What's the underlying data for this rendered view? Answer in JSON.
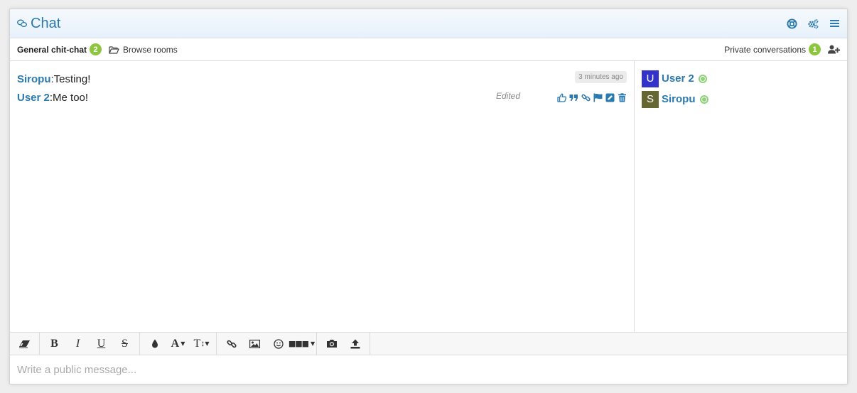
{
  "header": {
    "title": "Chat",
    "icons": [
      "help-lifebuoy-icon",
      "settings-gears-icon",
      "menu-icon"
    ]
  },
  "room_bar": {
    "current_room": "General chit-chat",
    "room_user_count": "2",
    "browse_rooms": "Browse rooms",
    "private_conversations": "Private conversations",
    "private_count": "1"
  },
  "messages": [
    {
      "author": "Siropu",
      "separator": ": ",
      "text": "Testing!",
      "time": "3 minutes ago"
    },
    {
      "author": "User 2",
      "separator": ": ",
      "text": "Me too!",
      "status": "Edited",
      "actions": [
        "like-icon",
        "quote-icon",
        "link-icon",
        "flag-icon",
        "edit-icon",
        "delete-icon"
      ]
    }
  ],
  "users": [
    {
      "initial": "U",
      "name": "User 2",
      "avatar_color": "#3333cc"
    },
    {
      "initial": "S",
      "name": "Siropu",
      "avatar_color": "#666633"
    }
  ],
  "editor": {
    "placeholder": "Write a public message..."
  },
  "colors": {
    "accent": "#2a7ab0",
    "badge": "#8cc63f",
    "online": "#8ed27a"
  }
}
